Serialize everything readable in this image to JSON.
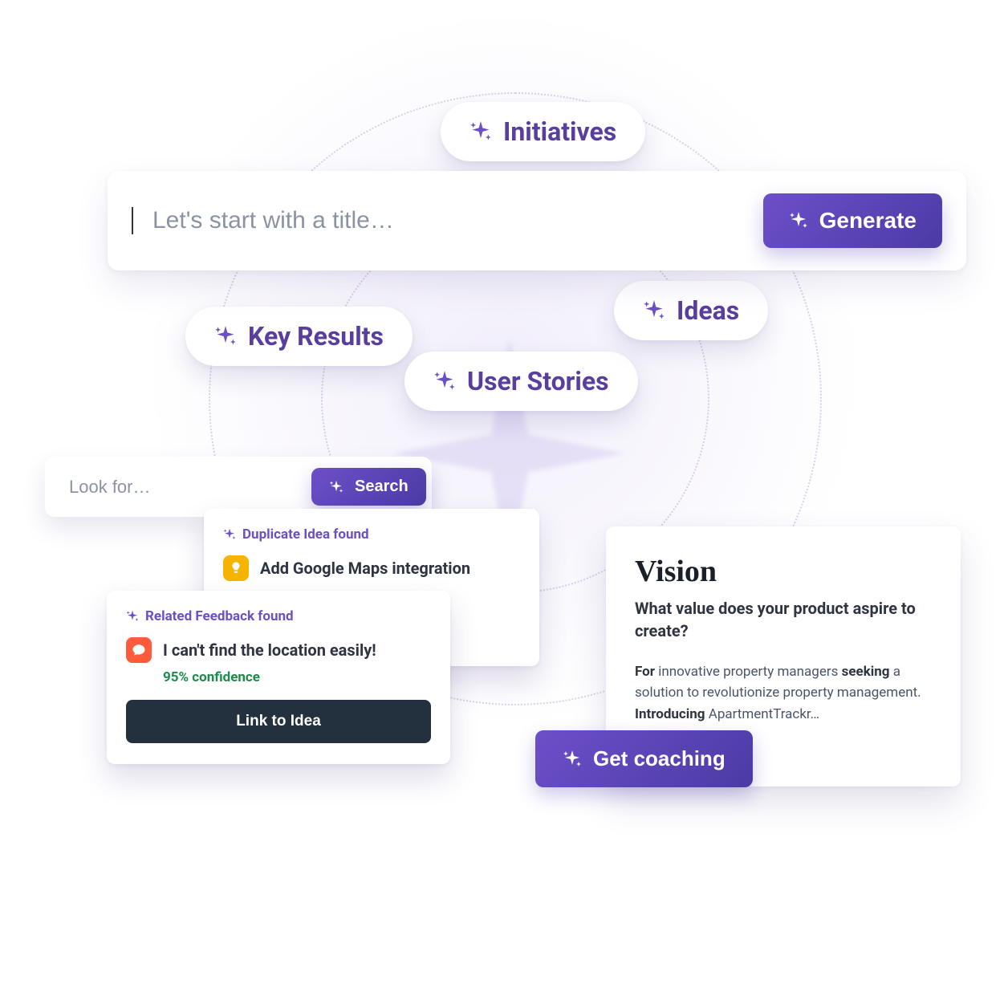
{
  "chips": {
    "initiatives": "Initiatives",
    "key_results": "Key Results",
    "user_stories": "User Stories",
    "ideas": "Ideas"
  },
  "title_bar": {
    "placeholder": "Let's start with a title…",
    "generate": "Generate"
  },
  "search": {
    "placeholder": "Look for…",
    "button": "Search"
  },
  "duplicate_card": {
    "header": "Duplicate Idea found",
    "item": "Add Google Maps integration"
  },
  "related_card": {
    "header": "Related Feedback found",
    "item": "I can't find the location easily!",
    "confidence": "95% confidence",
    "action": "Link to Idea"
  },
  "vision": {
    "title": "Vision",
    "subtitle": "What value does your product aspire to create?",
    "body_for": "For",
    "body_seg1": " innovative property managers ",
    "body_seek": "seeking",
    "body_seg2": " a solution to revolutionize property management. ",
    "body_intro": "Introducing",
    "body_seg3": " ApartmentTrackr…"
  },
  "coaching": {
    "button": "Get coaching"
  }
}
